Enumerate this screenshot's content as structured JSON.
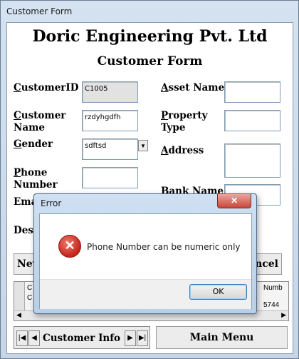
{
  "window": {
    "title": "Customer Form"
  },
  "header": {
    "company": "Doric Engineering Pvt. Ltd",
    "form_title": "Customer Form"
  },
  "fields": {
    "customer_id": {
      "label_first": "C",
      "label_rest": "ustomerID",
      "value": "C1005"
    },
    "customer_name": {
      "label_first": "C",
      "label_rest": "ustomer",
      "label_line2": "Name",
      "value": "rzdyhgdfh"
    },
    "gender": {
      "label_first": "G",
      "label_rest": "ender",
      "value": "sdftsd"
    },
    "phone": {
      "label_first": "P",
      "label_rest": "hone",
      "label_line2": "Number",
      "value": ""
    },
    "email": {
      "label_partial": "Ema"
    },
    "designation": {
      "label_partial": "Desi"
    },
    "asset_name": {
      "label_first": "A",
      "label_rest": "sset Name",
      "value": ""
    },
    "property_type": {
      "label_first": "P",
      "label_rest": "roperty",
      "label_line2": "Type",
      "value": ""
    },
    "address": {
      "label_first": "A",
      "label_rest": "ddress",
      "value": ""
    },
    "bank_name": {
      "label_first": "B",
      "label_rest": "ank Name",
      "value": ""
    }
  },
  "buttons": {
    "new_partial": "New",
    "cancel_partial": "ancel",
    "main_menu": "Main Menu"
  },
  "grid": {
    "row1": "C",
    "row2": "C",
    "col_partial": "Numb",
    "cell_partial": "5744"
  },
  "nav": {
    "label": "Customer Info",
    "first": "|◀",
    "prev": "◀",
    "next": "▶",
    "last": "▶|"
  },
  "dialog": {
    "title": "Error",
    "close": "✕",
    "message": "Phone Number can be numeric only",
    "ok": "OK",
    "icon": "error-icon"
  }
}
